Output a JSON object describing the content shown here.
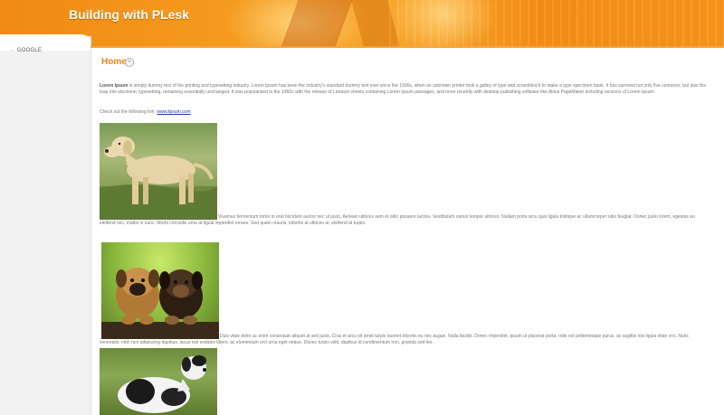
{
  "header": {
    "title": "Building with PLesk"
  },
  "sidebar": {
    "items": [
      {
        "label": "GOOGLE"
      }
    ]
  },
  "main": {
    "title": "Home",
    "intro_bold": "Lorem Ipsum",
    "intro_text": " is simply dummy text of the printing and typesetting industry. Lorem Ipsum has been the industry's standard dummy text ever since the 1500s, when an unknown printer took a galley of type and scrambled it to make a type specimen book. It has survived not only five centuries, but also the leap into electronic typesetting, remaining essentially unchanged. It was popularised in the 1960s with the release of Letraset sheets containing Lorem Ipsum passages, and more recently with desktop publishing software like Aldus PageMaker including versions of Lorem Ipsum.",
    "link_prefix": "Check out the following link: ",
    "link_text": "www.lipsum.com",
    "paragraph1": "Vivamus fermentum tortor in erat tincidunt auctor nec ut justo. Aenean ultrices sem et odio posuere lacinia. Vestibulum varius tempor ultrices. Nullam porta arcu quis ligula tristique ac ullamcorper odio feugiat. Donec justo lorem, egestas eu eleifend nec, mattis in nunc. Morbi convallis urna at ligula imperdiet ornare. Sed quam mauris, lobortis at ultrices at, eleifend at turpis.",
    "paragraph2": "Duis vitae dolor ac enim consequat aliquet at sed justo. Cras et arcu sit amet turpis laoreet lobortis eu nec augue. Nulla facilisi. Donec imperdiet, ipsum ut placerat porta, odio est pellentesque purus, ac sagittis nisi ligula vitae orci. Nunc venenatis, nibh non adipiscing dapibus, lacus nisl sodales libero, ac elementum orci urna eget neque. Donec turpis velit, dapibus id condimentum non, gravida sed leo."
  },
  "colors": {
    "accent": "#e8861c",
    "banner": "#f39218",
    "link": "#1b3f9a"
  },
  "icons": {
    "home_icon": "circle-plus-icon",
    "sidebar_bullet": "bullet-icon"
  }
}
